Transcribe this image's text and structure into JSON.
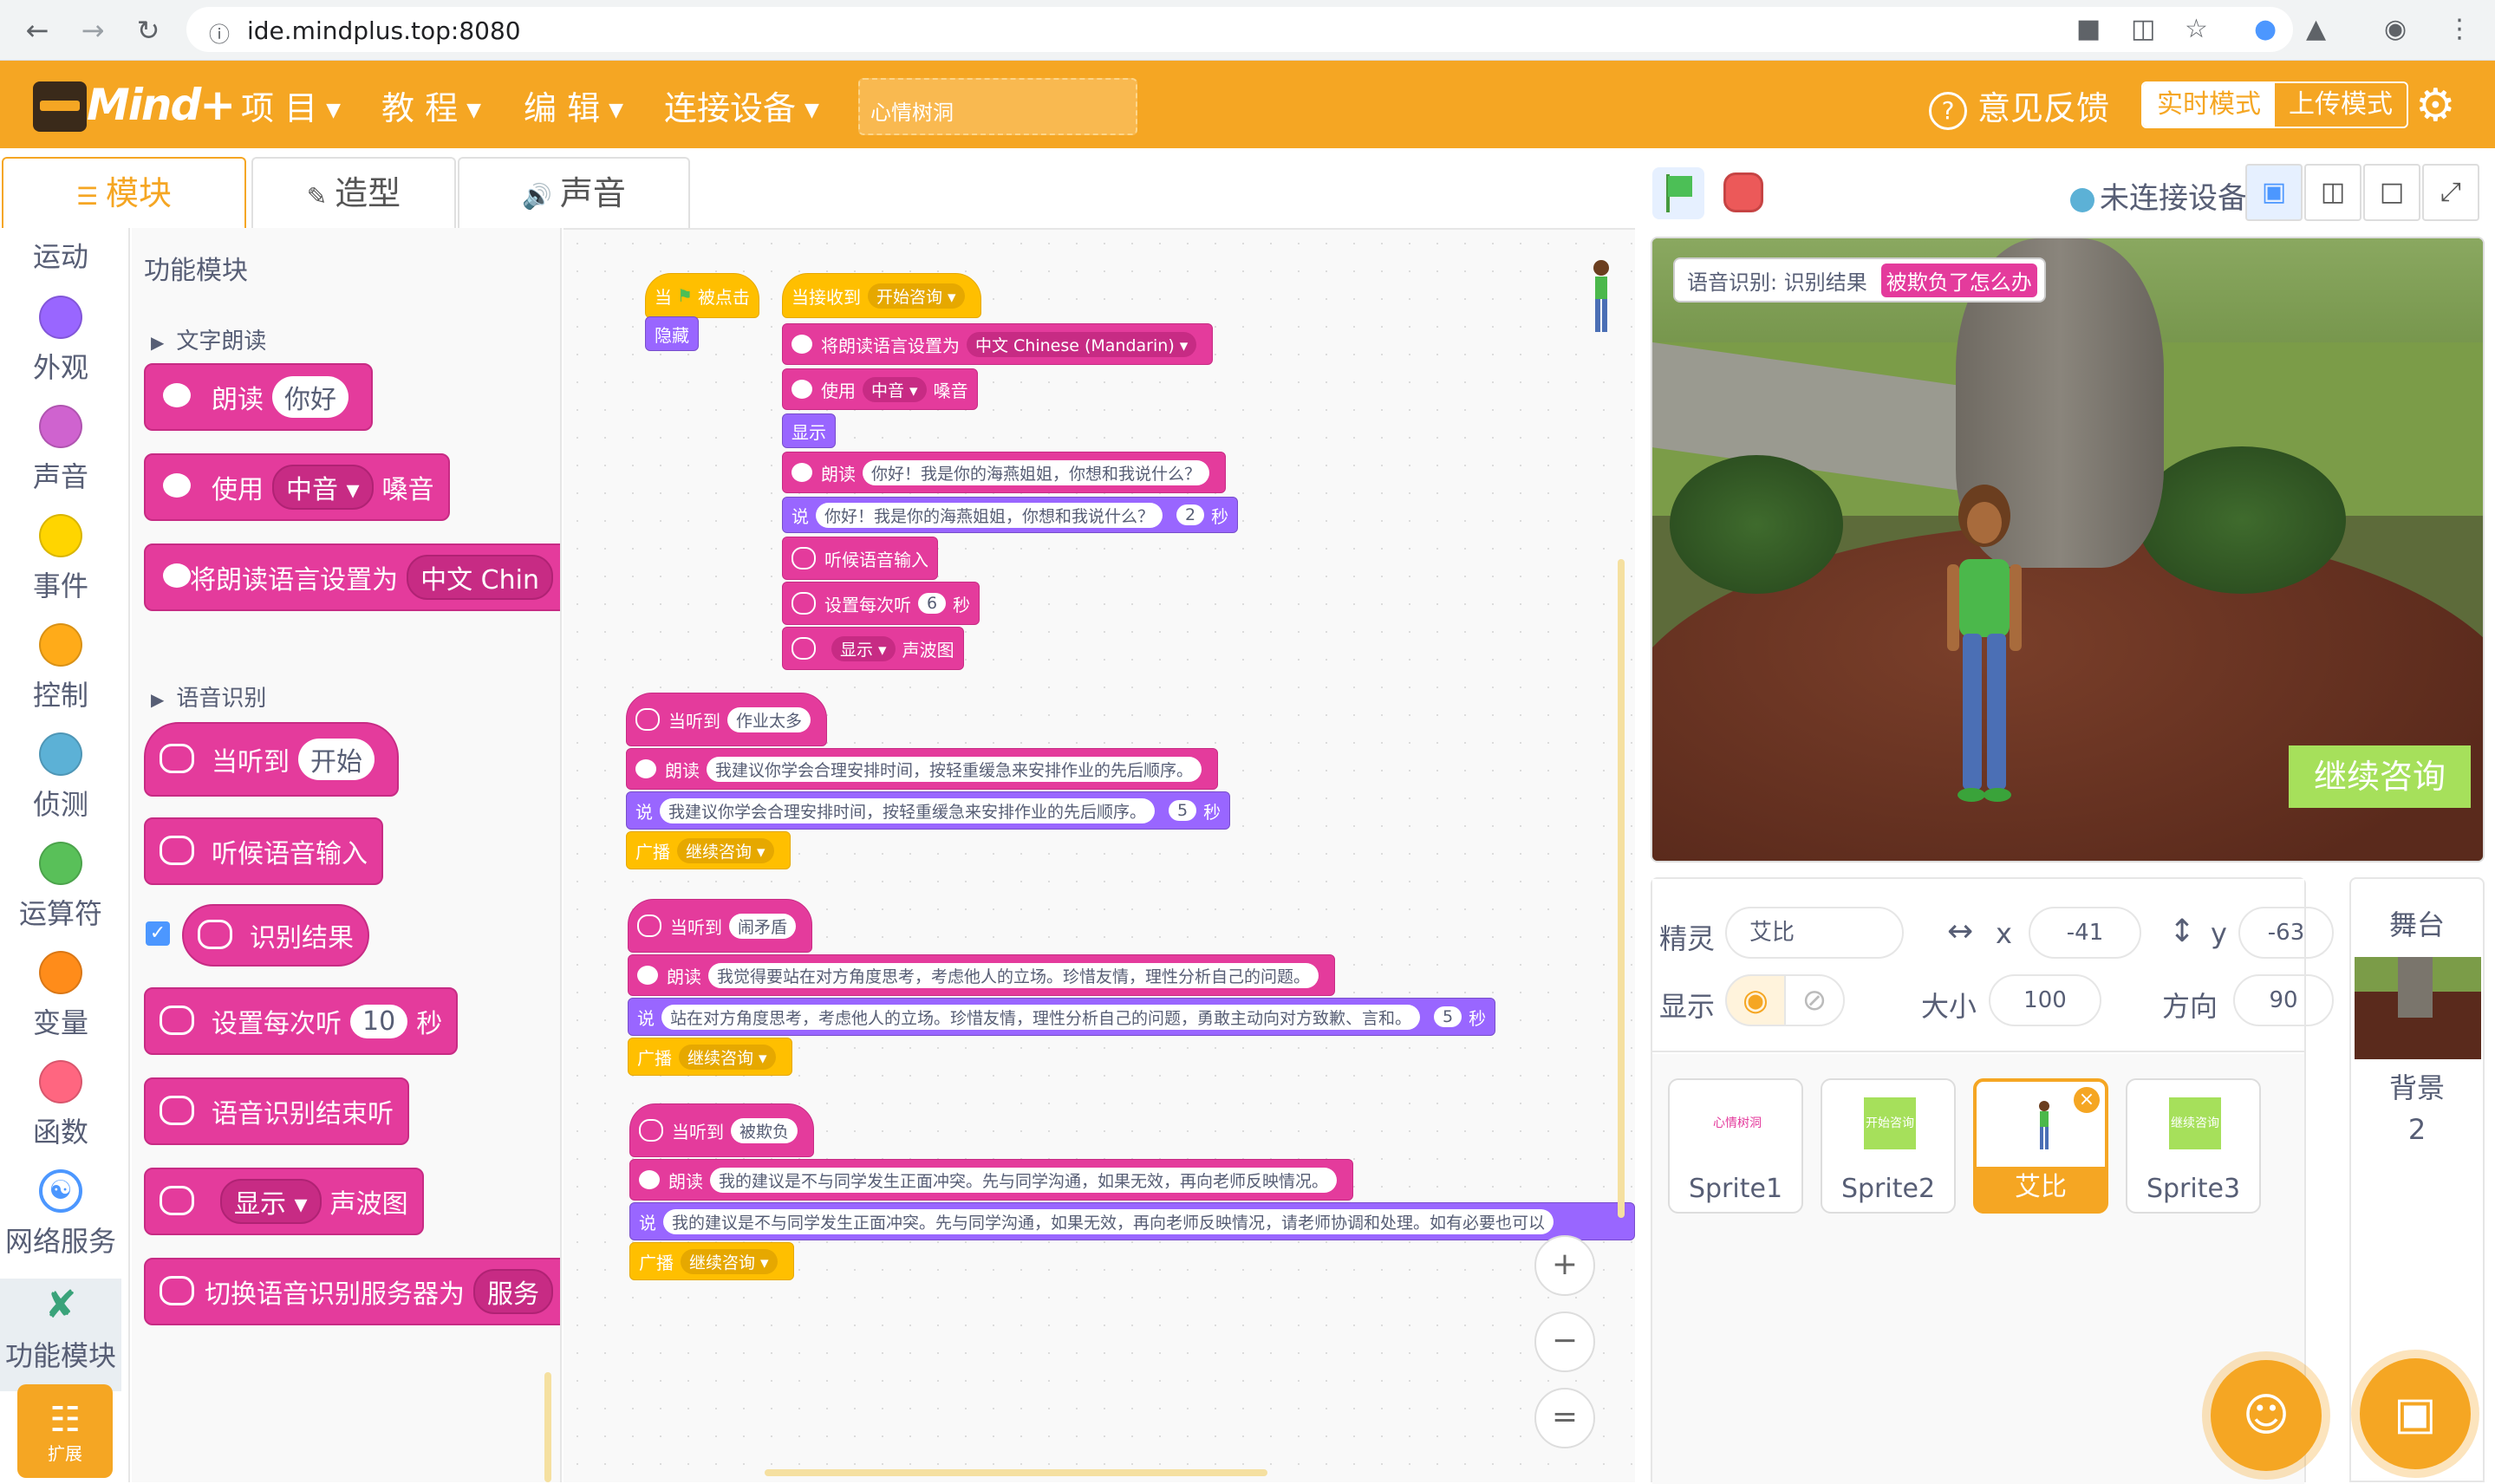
{
  "browser": {
    "url": "ide.mindplus.top:8080"
  },
  "app": {
    "logo_text": "Mind+",
    "menus": [
      "项 目",
      "教 程",
      "编 辑",
      "连接设备"
    ],
    "project_name": "心情树洞",
    "feedback": "意见反馈",
    "mode_live": "实时模式",
    "mode_upload": "上传模式",
    "accent": "#f5a623"
  },
  "tabs": {
    "blocks": "模块",
    "costumes": "造型",
    "sounds": "声音"
  },
  "categories": [
    {
      "label": "运动"
    },
    {
      "label": "外观",
      "color": "#9966ff"
    },
    {
      "label": "声音",
      "color": "#cf63cf"
    },
    {
      "label": "事件",
      "color": "#ffd500"
    },
    {
      "label": "控制",
      "color": "#ffab19"
    },
    {
      "label": "侦测",
      "color": "#5cb1d6"
    },
    {
      "label": "运算符",
      "color": "#59c059"
    },
    {
      "label": "变量",
      "color": "#ff8c1a"
    },
    {
      "label": "函数",
      "color": "#ff6680"
    },
    {
      "label": "网络服务"
    },
    {
      "label": "功能模块"
    }
  ],
  "extension_label": "扩展",
  "palette": {
    "title": "功能模块",
    "section_tts": "文字朗读",
    "section_asr": "语音识别",
    "b_speak": "朗读",
    "b_speak_arg": "你好",
    "b_use": "使用",
    "b_use_arg": "中音",
    "b_use_tail": "嗓音",
    "b_setlang": "将朗读语言设置为",
    "b_setlang_arg": "中文 Chin",
    "b_whenheard": "当听到",
    "b_whenheard_arg": "开始",
    "b_listen": "听候语音输入",
    "b_result": "识别结果",
    "b_setdur": "设置每次听",
    "b_setdur_arg": "10",
    "b_setdur_unit": "秒",
    "b_end": "语音识别结束听",
    "b_show_arg": "显示",
    "b_show_tail": "声波图",
    "b_switch": "切换语音识别服务器为",
    "b_switch_arg": "服务"
  },
  "scripts": {
    "s1_when": "当",
    "s1_clicked": "被点击",
    "s1_hide": "隐藏",
    "s2_recv": "当接收到",
    "s2_recv_arg": "开始咨询",
    "s2_setlang": "将朗读语言设置为",
    "s2_setlang_arg": "中文 Chinese (Mandarin)",
    "s2_use": "使用",
    "s2_use_arg": "中音",
    "s2_use_tail": "嗓音",
    "s2_show": "显示",
    "s2_speak": "朗读",
    "s2_speak_arg": "你好！我是你的海燕姐姐，你想和我说什么？",
    "s2_say": "说",
    "s2_say_arg": "你好！我是你的海燕姐姐，你想和我说什么？",
    "s2_say_n": "2",
    "s2_say_unit": "秒",
    "s2_listen": "听候语音输入",
    "s2_setdur": "设置每次听",
    "s2_setdur_n": "6",
    "s2_setdur_unit": "秒",
    "s2_disp_arg": "显示",
    "s2_disp_tail": "声波图",
    "h1_heard": "当听到",
    "h1_heard_arg": "作业太多",
    "h1_speak": "朗读",
    "h1_speak_arg": "我建议你学会合理安排时间，按轻重缓急来安排作业的先后顺序。",
    "h1_say": "说",
    "h1_say_arg": "我建议你学会合理安排时间，按轻重缓急来安排作业的先后顺序。",
    "h1_say_n": "5",
    "h1_say_unit": "秒",
    "h1_bcast": "广播",
    "h1_bcast_arg": "继续咨询",
    "h2_heard": "当听到",
    "h2_heard_arg": "闹矛盾",
    "h2_speak": "朗读",
    "h2_speak_arg": "我觉得要站在对方角度思考，考虑他人的立场。珍惜友情，理性分析自己的问题。",
    "h2_say": "说",
    "h2_say_arg": "站在对方角度思考，考虑他人的立场。珍惜友情，理性分析自己的问题，勇敢主动向对方致歉、言和。",
    "h2_say_n": "5",
    "h2_say_unit": "秒",
    "h2_bcast": "广播",
    "h2_bcast_arg": "继续咨询",
    "h3_heard": "当听到",
    "h3_heard_arg": "被欺负",
    "h3_speak": "朗读",
    "h3_speak_arg": "我的建议是不与同学发生正面冲突。先与同学沟通，如果无效，再向老师反映情况。",
    "h3_say": "说",
    "h3_say_arg": "我的建议是不与同学发生正面冲突。先与同学沟通，如果无效，再向老师反映情况，请老师协调和处理。如有必要也可以",
    "h3_bcast": "广播",
    "h3_bcast_arg": "继续咨询"
  },
  "zoom": {
    "in": "+",
    "out": "−",
    "reset": "="
  },
  "stage_header": {
    "connection": "未连接设备"
  },
  "stage": {
    "monitor_label": "语音识别: 识别结果",
    "monitor_value": "被欺负了怎么办",
    "continue_button": "继续咨询"
  },
  "sprite_info": {
    "sprite_label": "精灵",
    "sprite_name": "艾比",
    "x_label": "x",
    "x": "-41",
    "y_label": "y",
    "y": "-63",
    "show_label": "显示",
    "size_label": "大小",
    "size": "100",
    "dir_label": "方向",
    "direction": "90"
  },
  "sprites": [
    {
      "name": "Sprite1",
      "thumb_text": "心情树洞"
    },
    {
      "name": "Sprite2",
      "thumb_text": "开始咨询"
    },
    {
      "name": "艾比",
      "active": true
    },
    {
      "name": "Sprite3",
      "thumb_text": "继续咨询"
    }
  ],
  "stage_selector": {
    "title": "舞台",
    "backdrop_label": "背景",
    "backdrop_count": "2"
  }
}
